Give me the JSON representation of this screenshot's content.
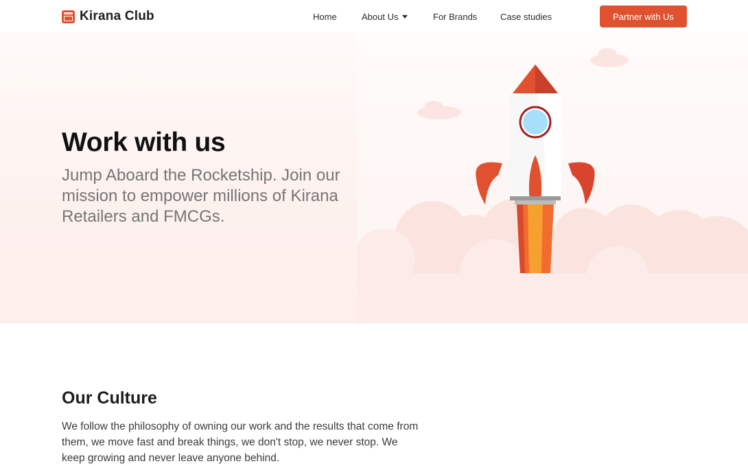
{
  "brand": {
    "name": "Kirana Club",
    "logo_icon": "storefront-icon",
    "accent_color": "#e0512f"
  },
  "nav": {
    "items": [
      {
        "label": "Home"
      },
      {
        "label": "About Us",
        "has_dropdown": true
      },
      {
        "label": "For Brands"
      },
      {
        "label": "Case studies"
      }
    ],
    "cta_label": "Partner with Us"
  },
  "hero": {
    "title": "Work with us",
    "subtitle": "Jump Aboard the Rocketship. Join our mission to empower millions of Kirana Retailers and FMCGs.",
    "illustration": "rocket-illustration"
  },
  "culture": {
    "title": "Our Culture",
    "body": "We follow the philosophy of owning our work and the results that come from them, we move fast and break things, we don't stop, we never stop. We keep growing and never leave anyone behind."
  }
}
